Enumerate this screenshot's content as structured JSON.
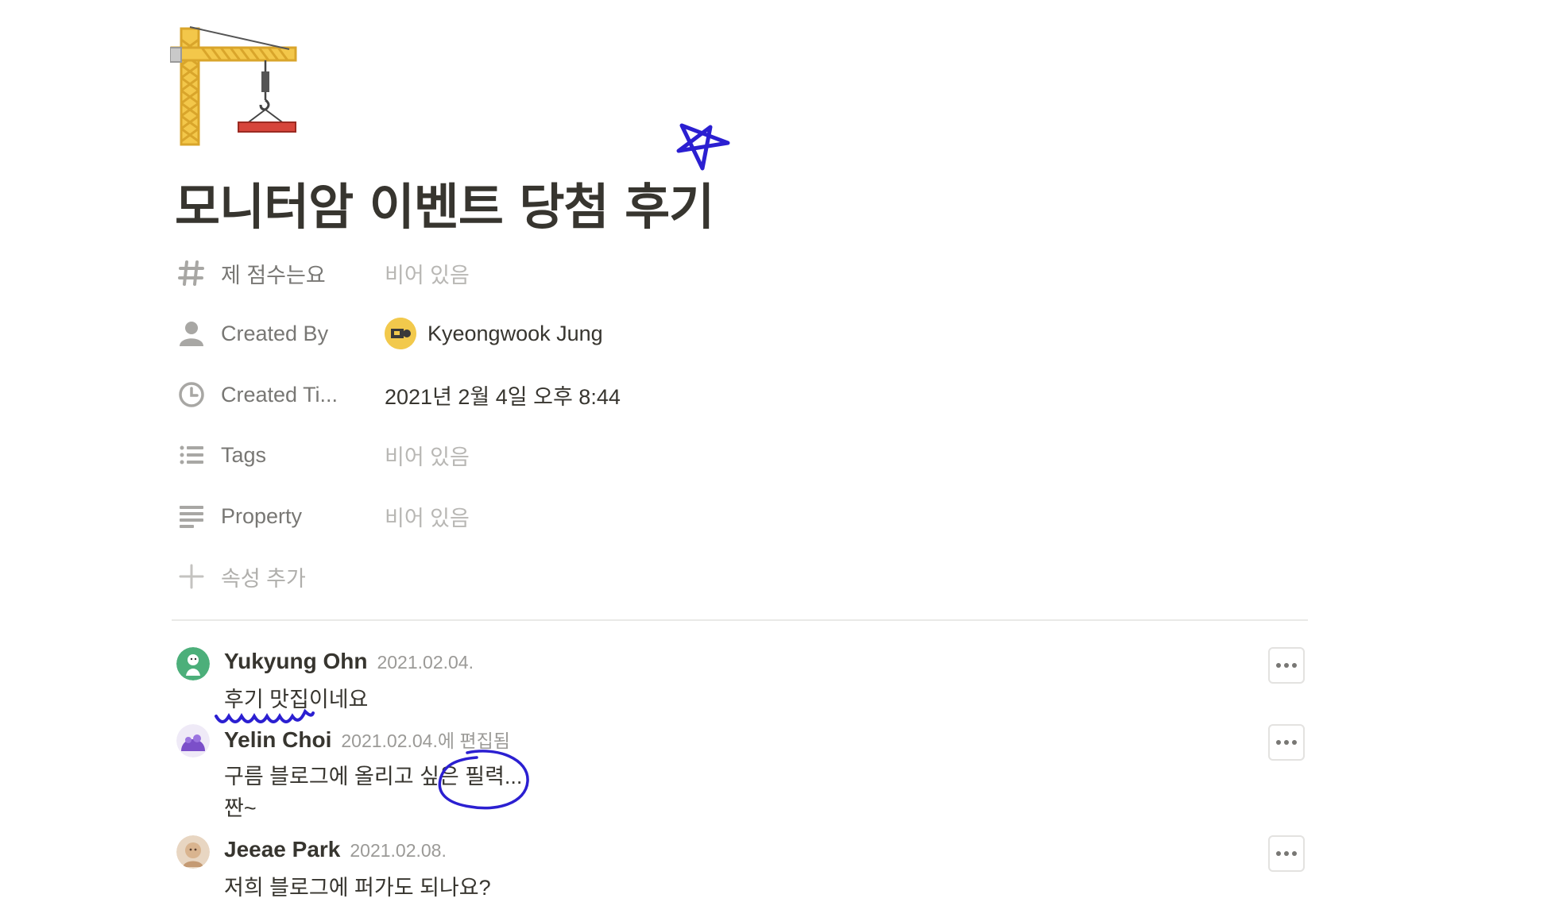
{
  "page": {
    "icon": "construction-crane-icon",
    "title": "모니터암 이벤트 당첨 후기"
  },
  "properties": [
    {
      "icon": "hash-icon",
      "label": "제 점수는요",
      "value": "비어 있음",
      "empty": true
    },
    {
      "icon": "person-icon",
      "label": "Created By",
      "value": "Kyeongwook Jung",
      "empty": false
    },
    {
      "icon": "clock-icon",
      "label": "Created Ti...",
      "value": "2021년 2월 4일 오후 8:44",
      "empty": false
    },
    {
      "icon": "list-icon",
      "label": "Tags",
      "value": "비어 있음",
      "empty": true
    },
    {
      "icon": "text-lines-icon",
      "label": "Property",
      "value": "비어 있음",
      "empty": true
    }
  ],
  "add_property": {
    "icon": "plus-icon",
    "label": "속성 추가"
  },
  "comments": [
    {
      "author": "Yukyung Ohn",
      "time": "2021.02.04.",
      "lines": [
        "후기 맛집이네요"
      ],
      "avatar_color": "#4caf7a"
    },
    {
      "author": "Yelin Choi",
      "time": "2021.02.04.에 편집됨",
      "lines": [
        "구름 블로그에 올리고 싶은 필력...",
        "짠~"
      ],
      "avatar_color": "#7b4fc9"
    },
    {
      "author": "Jeeae Park",
      "time": "2021.02.08.",
      "lines": [
        "저희 블로그에 퍼가도 되나요?"
      ],
      "avatar_color": "#d9b48f"
    }
  ],
  "colors": {
    "doodle_ink": "#2b1fd1",
    "text_main": "#37352f",
    "text_muted": "#787774"
  }
}
